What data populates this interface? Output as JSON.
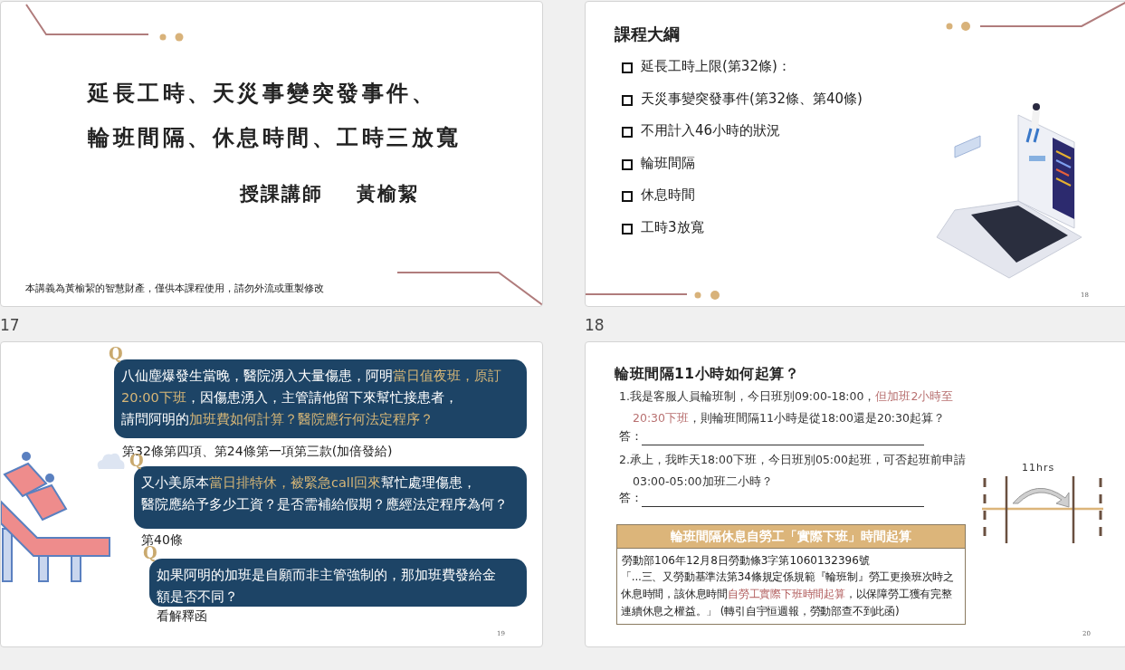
{
  "slides": [
    {
      "number": "17",
      "kind": "title",
      "title_lines": [
        "延長工時、天災事變突發事件、",
        "輪班間隔、休息時間、工時三放寬"
      ],
      "presenter_label": "授課講師",
      "presenter_name": "黃榆絜",
      "footer": "本講義為黃榆絜的智慧財產，僅供本課程使用，請勿外流或重製修改"
    },
    {
      "number": "18",
      "kind": "outline",
      "title": "課程大綱",
      "items": [
        "延長工時上限(第32條)：",
        "天災事變突發事件(第32條、第40條)",
        "不用計入46小時的狀況",
        "輪班間隔",
        "休息時間",
        "工時3放寬"
      ],
      "page_number": "18"
    },
    {
      "kind": "questions",
      "questions": [
        {
          "marker": "Q",
          "lines": [
            [
              {
                "text": "八仙塵爆發生當晚，醫院湧入大量傷患，阿明",
                "highlight": false
              },
              {
                "text": "當日值夜班，原訂20:00下班",
                "highlight": true
              },
              {
                "text": "，因傷患湧入，主管請他留下來幫忙接患者，",
                "highlight": false
              }
            ],
            [
              {
                "text": "請問阿明的",
                "highlight": false
              },
              {
                "text": "加班費如何計算？醫院應行何法定程序？",
                "highlight": true
              }
            ]
          ],
          "answer": "第32條第四項、第24條第一項第三款(加倍發給)"
        },
        {
          "marker": "Q",
          "lines": [
            [
              {
                "text": "又小美原本",
                "highlight": false
              },
              {
                "text": "當日排特休，被緊急call回來",
                "highlight": true
              },
              {
                "text": "幫忙處理傷患，",
                "highlight": false
              }
            ],
            [
              {
                "text": "醫院應給予多少工資？是否需補給假期？應經法定程序為何？",
                "highlight": false
              }
            ]
          ],
          "answer": "第40條"
        },
        {
          "marker": "Q",
          "lines": [
            [
              {
                "text": "如果阿明的加班是自願而非主管強制的，那加班費發給金額是否不同？",
                "highlight": false
              }
            ]
          ],
          "answer": "看解釋函"
        }
      ],
      "page_number": "19"
    },
    {
      "kind": "shift",
      "title": "輪班間隔11小時如何起算？",
      "questions": [
        {
          "segments": [
            {
              "text": "1.我是客服人員輪班制，今日班別09:00-18:00，",
              "highlight": false
            },
            {
              "text": "但加班2小時至20:30下班",
              "highlight": true
            },
            {
              "text": "，則輪班間隔11小時是從18:00還是20:30起算？",
              "highlight": false
            }
          ],
          "answer_label": "答："
        },
        {
          "segments": [
            {
              "text": "2.承上，我昨天18:00下班，今日班別05:00起班，可否起班前申請03:00-05:00加班二小時？",
              "highlight": false
            }
          ],
          "answer_label": "答："
        }
      ],
      "diagram_label": "11hrs",
      "box": {
        "header": "輪班間隔休息自勞工「實際下班」時間起算",
        "reference": "勞動部106年12月8日勞動條3字第1060132396號",
        "segments": [
          {
            "text": "「...三、又勞動基準法第34條規定係規範『輪班制』勞工更換班次時之休息時間，該休息時間",
            "highlight": false
          },
          {
            "text": "自勞工實際下班時間起算",
            "highlight": true
          },
          {
            "text": "，以保障勞工獲有完整連續休息之權益。」 (轉引自宇恒週報，勞動部查不到此函)",
            "highlight": false
          }
        ]
      },
      "page_number": "20"
    }
  ]
}
